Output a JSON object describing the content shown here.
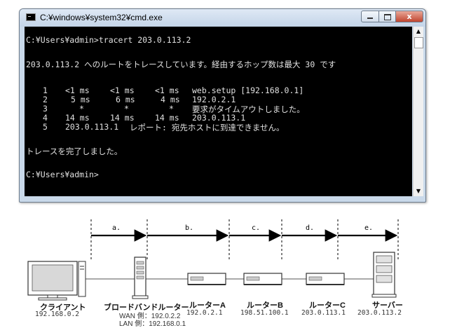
{
  "window": {
    "title": "C:¥windows¥system32¥cmd.exe",
    "min_label": "",
    "max_label": "",
    "close_label": "x"
  },
  "console": {
    "command_line": "C:¥Users¥admin>tracert 203.0.113.2",
    "header": "203.0.113.2 へのルートをトレースしています。経由するホップ数は最大 30 です",
    "hops": [
      {
        "n": "1",
        "t1": "<1 ms",
        "t2": "<1 ms",
        "t3": "<1 ms",
        "host": "web.setup [192.168.0.1]"
      },
      {
        "n": "2",
        "t1": "5 ms",
        "t2": "6 ms",
        "t3": "4 ms",
        "host": "192.0.2.1"
      },
      {
        "n": "3",
        "t1": "*",
        "t2": "*",
        "t3": "*",
        "host": "要求がタイムアウトしました。"
      },
      {
        "n": "4",
        "t1": "14 ms",
        "t2": "14 ms",
        "t3": "14 ms",
        "host": "203.0.113.1"
      },
      {
        "n": "5",
        "t1": "203.0.113.1",
        "t2": "",
        "t3": "",
        "host": "レポート: 宛先ホストに到達できません。"
      }
    ],
    "complete": "トレースを完了しました。",
    "prompt": "C:¥Users¥admin>"
  },
  "diagram": {
    "segments": [
      "a.",
      "b.",
      "c.",
      "d.",
      "e."
    ],
    "devices": [
      {
        "name": "クライアント",
        "ip": "192.168.0.2",
        "icon": "pc-icon"
      },
      {
        "name": "ブロードバンドルーター",
        "wan": "WAN 側：192.0.2.2",
        "lan": "LAN 側：192.168.0.1",
        "icon": "broadband-router-icon"
      },
      {
        "name": "ルーターA",
        "ip": "192.0.2.1",
        "icon": "router-icon"
      },
      {
        "name": "ルーターB",
        "ip": "198.51.100.1",
        "icon": "router-icon"
      },
      {
        "name": "ルーターC",
        "ip": "203.0.113.1",
        "icon": "router-icon"
      },
      {
        "name": "サーバー",
        "ip": "203.0.113.2",
        "icon": "server-icon"
      }
    ]
  }
}
